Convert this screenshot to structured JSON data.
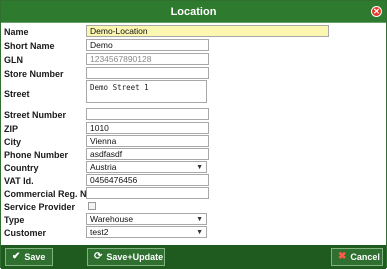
{
  "dialog": {
    "title": "Location",
    "close_icon": "close-icon"
  },
  "form": {
    "name": {
      "label": "Name",
      "value": "Demo-Location"
    },
    "short_name": {
      "label": "Short Name",
      "value": "Demo"
    },
    "gln": {
      "label": "GLN",
      "placeholder": "1234567890128"
    },
    "store_number": {
      "label": "Store Number",
      "value": ""
    },
    "street": {
      "label": "Street",
      "value": "Demo Street 1"
    },
    "street_number": {
      "label": "Street Number",
      "value": ""
    },
    "zip": {
      "label": "ZIP",
      "value": "1010"
    },
    "city": {
      "label": "City",
      "value": "Vienna"
    },
    "phone_number": {
      "label": "Phone Number",
      "value": "asdfasdf"
    },
    "country": {
      "label": "Country",
      "value": "Austria"
    },
    "vat_id": {
      "label": "VAT Id.",
      "value": "0456476456"
    },
    "commercial_reg": {
      "label": "Commercial Reg. No.",
      "value": ""
    },
    "service_provider": {
      "label": "Service Provider",
      "checked": false
    },
    "type": {
      "label": "Type",
      "value": "Warehouse"
    },
    "customer": {
      "label": "Customer",
      "value": "test2"
    }
  },
  "footer": {
    "save_label": "Save",
    "save_update_label": "Save+Update",
    "cancel_label": "Cancel"
  },
  "colors": {
    "title_bar": "#2e7a2e",
    "frame": "#1f5a1f",
    "highlight_field": "#fbf7b0",
    "close": "#e33a2c"
  }
}
